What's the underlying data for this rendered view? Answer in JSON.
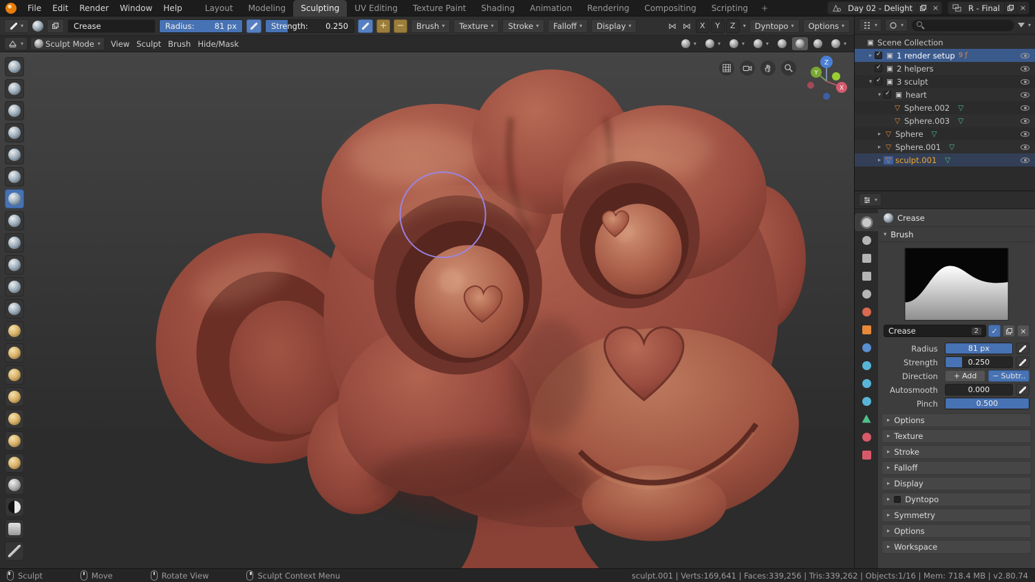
{
  "topbar": {
    "menus": [
      {
        "label": "File"
      },
      {
        "label": "Edit"
      },
      {
        "label": "Render"
      },
      {
        "label": "Window"
      },
      {
        "label": "Help"
      }
    ],
    "workspaces": [
      {
        "label": "Layout"
      },
      {
        "label": "Modeling"
      },
      {
        "label": "Sculpting",
        "cls": "active"
      },
      {
        "label": "UV Editing"
      },
      {
        "label": "Texture Paint"
      },
      {
        "label": "Shading"
      },
      {
        "label": "Animation"
      },
      {
        "label": "Rendering"
      },
      {
        "label": "Compositing"
      },
      {
        "label": "Scripting"
      },
      {
        "label": "+",
        "cls": "add"
      }
    ],
    "scene_label": "Day 02 - Delight",
    "view_layer_label": "R - Final",
    "close_glyph": "×"
  },
  "tool_header": {
    "brush_name": "Crease",
    "radius": {
      "label": "Radius:",
      "value": "81 px",
      "fill": 100
    },
    "strength": {
      "label": "Strength:",
      "value": "0.250",
      "fill": 25
    },
    "plus": "+",
    "minus": "−",
    "dropdowns": [
      {
        "label": "Brush"
      },
      {
        "label": "Texture"
      },
      {
        "label": "Stroke"
      },
      {
        "label": "Falloff"
      },
      {
        "label": "Display"
      }
    ],
    "mirror_icon_glyph": "⋈",
    "mirror": [
      {
        "label": "X"
      },
      {
        "label": "Y"
      },
      {
        "label": "Z"
      }
    ],
    "dyntopo_label": "Dyntopo",
    "options_label": "Options"
  },
  "mode_header": {
    "mode_label": "Sculpt Mode",
    "menus": [
      {
        "label": "View"
      },
      {
        "label": "Sculpt"
      },
      {
        "label": "Brush"
      },
      {
        "label": "Hide/Mask"
      }
    ],
    "right_icons": [
      {
        "name": "visibility-dropdown-icon",
        "cls": "dd"
      },
      {
        "name": "select-tool-dropdown-icon",
        "cls": "dd"
      },
      {
        "name": "overlays-dropdown-icon",
        "cls": "dd"
      },
      {
        "name": "gizmos-dropdown-icon",
        "cls": "dd"
      },
      {
        "name": "shading-wireframe-icon",
        "cls": ""
      },
      {
        "name": "shading-solid-icon",
        "cls": "active"
      },
      {
        "name": "shading-material-icon",
        "cls": ""
      },
      {
        "name": "shading-rendered-icon",
        "cls": "dd"
      }
    ]
  },
  "toolbar": {
    "brushes": [
      {
        "name": "draw-brush-button",
        "variant": "v-cool"
      },
      {
        "name": "clay-brush-button",
        "variant": "v-cool"
      },
      {
        "name": "clay-strips-brush-button",
        "variant": "v-cool"
      },
      {
        "name": "layer-brush-button",
        "variant": "v-cool"
      },
      {
        "name": "inflate-brush-button",
        "variant": "v-cool"
      },
      {
        "name": "blob-brush-button",
        "variant": "v-cool"
      },
      {
        "name": "crease-brush-button",
        "variant": "v-cool",
        "cls": "active"
      },
      {
        "name": "smooth-brush-button",
        "variant": "v-cool"
      },
      {
        "name": "flatten-brush-button",
        "variant": "v-cool"
      },
      {
        "name": "fill-brush-button",
        "variant": "v-cool"
      },
      {
        "name": "scrape-brush-button",
        "variant": "v-cool"
      },
      {
        "name": "pinch-brush-button",
        "variant": "v-cool"
      },
      {
        "name": "grab-brush-button",
        "variant": "v-warm"
      },
      {
        "name": "elastic-deform-brush-button",
        "variant": "v-warm"
      },
      {
        "name": "snake-hook-brush-button",
        "variant": "v-warm"
      },
      {
        "name": "thumb-brush-button",
        "variant": "v-warm"
      },
      {
        "name": "pose-brush-button",
        "variant": "v-warm"
      },
      {
        "name": "nudge-brush-button",
        "variant": "v-warm"
      },
      {
        "name": "rotate-brush-button",
        "variant": "v-warm"
      },
      {
        "name": "slide-relax-brush-button",
        "variant": "v-noise"
      },
      {
        "name": "mask-brush-button",
        "variant": "v-half"
      },
      {
        "name": "box-mask-brush-button",
        "variant": "v-doc"
      },
      {
        "name": "annotate-brush-button",
        "variant": "v-pencil"
      }
    ]
  },
  "viewport": {
    "gizmo": {
      "x": "X",
      "y": "Y",
      "z": "Z"
    },
    "nav": [
      {
        "name": "grid-icon"
      },
      {
        "name": "camera-icon"
      },
      {
        "name": "pan-hand-icon"
      },
      {
        "name": "zoom-icon"
      }
    ]
  },
  "outliner": {
    "rows": [
      {
        "indent": 0,
        "arrow": "",
        "glyph": "▣",
        "glyph_color": "#cccccc",
        "label": "Scene Collection",
        "cls": "nocheck noeye"
      },
      {
        "indent": 1,
        "arrow": "▸",
        "glyph": "▣",
        "glyph_color": "#cccccc",
        "label": "1 render setup",
        "cls": "selected",
        "badges": "9 ƒ"
      },
      {
        "indent": 1,
        "arrow": "",
        "glyph": "▣",
        "glyph_color": "#cccccc",
        "label": "2 helpers",
        "cls": ""
      },
      {
        "indent": 1,
        "arrow": "▾",
        "glyph": "▣",
        "glyph_color": "#cccccc",
        "label": "3 sculpt",
        "cls": ""
      },
      {
        "indent": 2,
        "arrow": "▾",
        "glyph": "▣",
        "glyph_color": "#cccccc",
        "label": "heart",
        "cls": ""
      },
      {
        "indent": 3,
        "arrow": "",
        "glyph": "▽",
        "glyph_color": "#e8883a",
        "glyph2": "▽",
        "glyph2_color": "#4fc08a",
        "label": "Sphere.002",
        "cls": "nocheck"
      },
      {
        "indent": 3,
        "arrow": "",
        "glyph": "▽",
        "glyph_color": "#e8883a",
        "glyph2": "▽",
        "glyph2_color": "#4fc08a",
        "label": "Sphere.003",
        "cls": "nocheck"
      },
      {
        "indent": 2,
        "arrow": "▸",
        "glyph": "▽",
        "glyph_color": "#e8883a",
        "glyph2": "▽",
        "glyph2_color": "#4fc08a",
        "label": "Sphere",
        "cls": "nocheck"
      },
      {
        "indent": 2,
        "arrow": "▸",
        "glyph": "▽",
        "glyph_color": "#e8883a",
        "glyph2": "▽",
        "glyph2_color": "#4fc08a",
        "label": "Sphere.001",
        "cls": "nocheck"
      },
      {
        "indent": 2,
        "arrow": "▸",
        "glyph": "▽",
        "glyph_color": "#e8883a",
        "glyph2": "▽",
        "glyph2_color": "#4fc08a",
        "label": "sculpt.001",
        "cls": "nocheck activerow",
        "label_color": "#f0a832",
        "icon_cls": "sel-bg"
      }
    ]
  },
  "properties": {
    "tabs": [
      {
        "name": "tab-active-tool",
        "shape": "shape-gear",
        "color": "#c8c8c8",
        "cls": "active"
      },
      {
        "name": "tab-render",
        "shape": "shape-circle",
        "color": "#b5b5b5",
        "cls": ""
      },
      {
        "name": "tab-output",
        "shape": "shape-square",
        "color": "#b5b5b5",
        "cls": ""
      },
      {
        "name": "tab-view-layer",
        "shape": "shape-square",
        "color": "#b5b5b5",
        "cls": ""
      },
      {
        "name": "tab-scene",
        "shape": "shape-circle",
        "color": "#b5b5b5",
        "cls": ""
      },
      {
        "name": "tab-world",
        "shape": "shape-circle",
        "color": "#d86a50",
        "cls": ""
      },
      {
        "name": "tab-object",
        "shape": "shape-square",
        "color": "#e8883a",
        "cls": ""
      },
      {
        "name": "tab-modifiers",
        "shape": "shape-circle",
        "color": "#5a8fd0",
        "cls": ""
      },
      {
        "name": "tab-particles",
        "shape": "shape-circle",
        "color": "#58b5d8",
        "cls": ""
      },
      {
        "name": "tab-physics",
        "shape": "shape-circle",
        "color": "#58b5d8",
        "cls": ""
      },
      {
        "name": "tab-constraints",
        "shape": "shape-circle",
        "color": "#58b5d8",
        "cls": ""
      },
      {
        "name": "tab-object-data",
        "shape": "shape-triangle",
        "color": "#4fc08a",
        "cls": ""
      },
      {
        "name": "tab-material",
        "shape": "shape-circle",
        "color": "#d85a6a",
        "cls": ""
      },
      {
        "name": "tab-texture",
        "shape": "shape-square",
        "color": "#d85a6a",
        "cls": ""
      }
    ],
    "breadcrumb_label": "Crease",
    "brush_panel_title": "Brush",
    "name_field": {
      "value": "Crease",
      "count": "2",
      "check_glyph": "✓",
      "close_glyph": "×"
    },
    "radius": {
      "label": "Radius",
      "value": "81 px",
      "fill": 100
    },
    "strength": {
      "label": "Strength",
      "value": "0.250",
      "fill": 25
    },
    "direction": {
      "label": "Direction",
      "plus": "+",
      "add": "Add",
      "minus": "−",
      "subtract": "Subtr.."
    },
    "autosmooth": {
      "label": "Autosmooth",
      "value": "0.000",
      "fill": 0
    },
    "pinch": {
      "label": "Pinch",
      "value": "0.500",
      "fill": 100
    },
    "sections": [
      {
        "label": "Options",
        "chkcls": ""
      },
      {
        "label": "Texture",
        "chkcls": ""
      },
      {
        "label": "Stroke",
        "chkcls": ""
      },
      {
        "label": "Falloff",
        "chkcls": ""
      },
      {
        "label": "Display",
        "chkcls": ""
      },
      {
        "label": "Dyntopo",
        "chkcls": "show"
      },
      {
        "label": "Symmetry",
        "chkcls": ""
      },
      {
        "label": "Options",
        "chkcls": ""
      },
      {
        "label": "Workspace",
        "chkcls": ""
      }
    ]
  },
  "statusbar": {
    "hints": [
      {
        "mouse": "lmb",
        "label": "Sculpt"
      },
      {
        "mouse": "mmb",
        "label": "Move"
      },
      {
        "mouse": "mmb",
        "label": "Rotate View"
      },
      {
        "mouse": "rmb",
        "label": "Sculpt Context Menu"
      }
    ],
    "stats": "sculpt.001 | Verts:169,641 | Faces:339,256 | Tris:339,262 | Objects:1/16 | Mem: 718.4 MB | v2.80.74"
  }
}
